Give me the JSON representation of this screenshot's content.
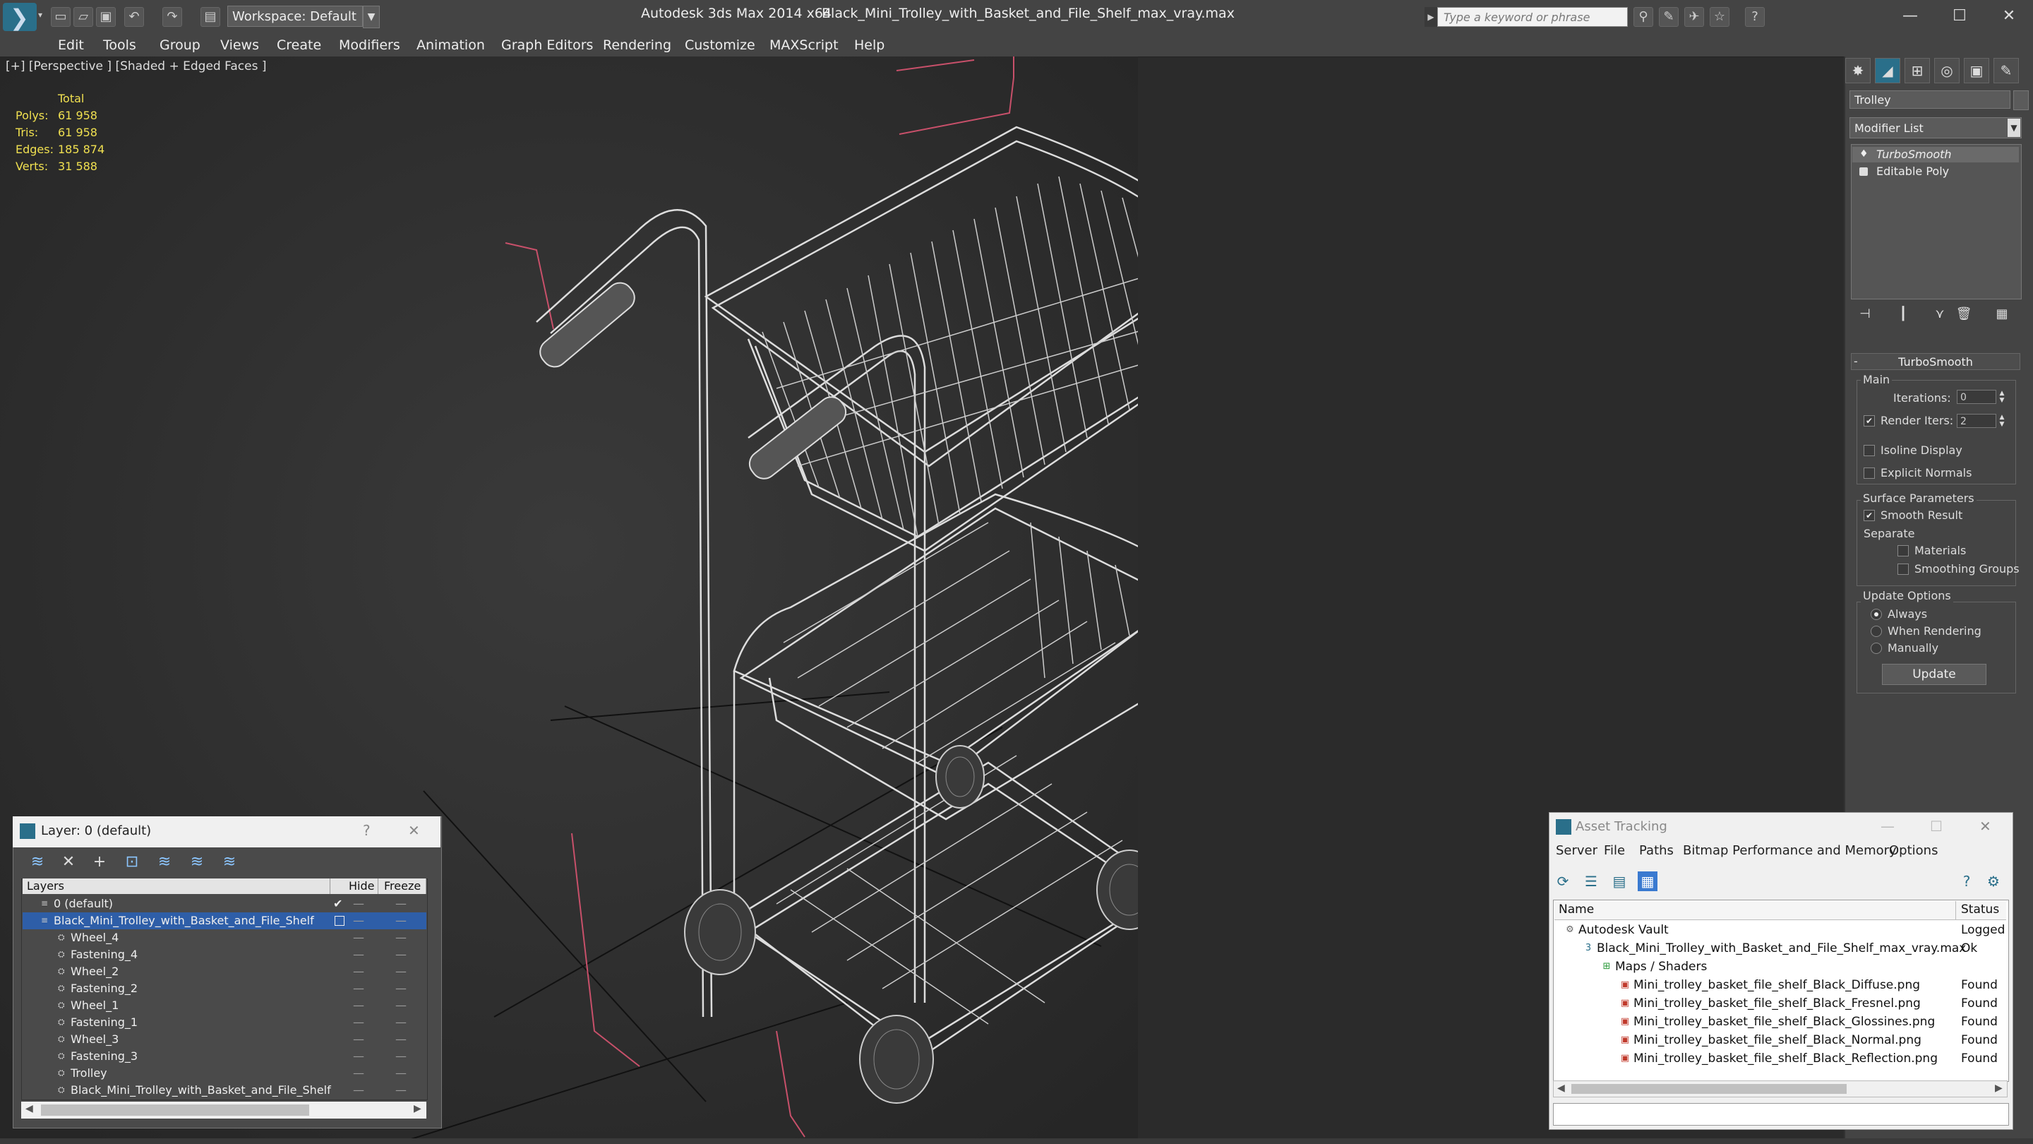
{
  "titlebar": {
    "workspace": "Workspace: Default",
    "app": "Autodesk 3ds Max  2014 x64",
    "file": "Black_Mini_Trolley_with_Basket_and_File_Shelf_max_vray.max",
    "search_placeholder": "Type a keyword or phrase"
  },
  "menu": [
    "Edit",
    "Tools",
    "Group",
    "Views",
    "Create",
    "Modifiers",
    "Animation",
    "Graph Editors",
    "Rendering",
    "Customize",
    "MAXScript",
    "Help"
  ],
  "viewport": {
    "label": "[+] [Perspective ] [Shaded + Edged Faces ]",
    "stats": {
      "header": "Total",
      "rows": [
        {
          "label": "Polys:",
          "value": "61 958"
        },
        {
          "label": "Tris:",
          "value": "61 958"
        },
        {
          "label": "Edges:",
          "value": "185 874"
        },
        {
          "label": "Verts:",
          "value": "31 588"
        }
      ]
    }
  },
  "command_panel": {
    "object_name": "Trolley",
    "modifier_list": "Modifier List",
    "stack": [
      "TurboSmooth",
      "Editable Poly"
    ],
    "rollout": "TurboSmooth",
    "main": {
      "group": "Main",
      "iterations_label": "Iterations:",
      "iterations_value": "0",
      "render_iters_label": "Render Iters:",
      "render_iters_value": "2",
      "render_iters_checked": true,
      "isoline": "Isoline Display",
      "explicit": "Explicit Normals"
    },
    "surface": {
      "group": "Surface Parameters",
      "smooth": "Smooth Result",
      "smooth_checked": true,
      "separate": "Separate",
      "materials": "Materials",
      "smoothing_groups": "Smoothing Groups"
    },
    "update": {
      "group": "Update Options",
      "always": "Always",
      "when_rendering": "When Rendering",
      "manually": "Manually",
      "button": "Update"
    }
  },
  "layer_window": {
    "title": "Layer: 0 (default)",
    "help": "?",
    "close": "✕",
    "columns": {
      "layers": "Layers",
      "hide": "Hide",
      "freeze": "Freeze"
    },
    "rows": [
      {
        "name": "0 (default)",
        "level": 0,
        "selected": false,
        "check": true
      },
      {
        "name": "Black_Mini_Trolley_with_Basket_and_File_Shelf",
        "level": 0,
        "selected": true,
        "check": false
      },
      {
        "name": "Wheel_4",
        "level": 1,
        "selected": false,
        "check": false
      },
      {
        "name": "Fastening_4",
        "level": 1,
        "selected": false,
        "check": false
      },
      {
        "name": "Wheel_2",
        "level": 1,
        "selected": false,
        "check": false
      },
      {
        "name": "Fastening_2",
        "level": 1,
        "selected": false,
        "check": false
      },
      {
        "name": "Wheel_1",
        "level": 1,
        "selected": false,
        "check": false
      },
      {
        "name": "Fastening_1",
        "level": 1,
        "selected": false,
        "check": false
      },
      {
        "name": "Wheel_3",
        "level": 1,
        "selected": false,
        "check": false
      },
      {
        "name": "Fastening_3",
        "level": 1,
        "selected": false,
        "check": false
      },
      {
        "name": "Trolley",
        "level": 1,
        "selected": false,
        "check": false
      },
      {
        "name": "Black_Mini_Trolley_with_Basket_and_File_Shelf",
        "level": 1,
        "selected": false,
        "check": false
      }
    ]
  },
  "asset_window": {
    "title": "Asset Tracking",
    "menu": [
      "Server",
      "File",
      "Paths",
      "Bitmap Performance and Memory",
      "Options"
    ],
    "columns": {
      "name": "Name",
      "status": "Status"
    },
    "rows": [
      {
        "name": "Autodesk Vault",
        "status": "Logged",
        "level": 0,
        "icon": "vault"
      },
      {
        "name": "Black_Mini_Trolley_with_Basket_and_File_Shelf_max_vray.max",
        "status": "Ok",
        "level": 1,
        "icon": "max"
      },
      {
        "name": "Maps / Shaders",
        "status": "",
        "level": 2,
        "icon": "maps"
      },
      {
        "name": "Mini_trolley_basket_file_shelf_Black_Diffuse.png",
        "status": "Found",
        "level": 3,
        "icon": "png"
      },
      {
        "name": "Mini_trolley_basket_file_shelf_Black_Fresnel.png",
        "status": "Found",
        "level": 3,
        "icon": "png"
      },
      {
        "name": "Mini_trolley_basket_file_shelf_Black_Glossines.png",
        "status": "Found",
        "level": 3,
        "icon": "png"
      },
      {
        "name": "Mini_trolley_basket_file_shelf_Black_Normal.png",
        "status": "Found",
        "level": 3,
        "icon": "png"
      },
      {
        "name": "Mini_trolley_basket_file_shelf_Black_Reflection.png",
        "status": "Found",
        "level": 3,
        "icon": "png"
      }
    ]
  }
}
